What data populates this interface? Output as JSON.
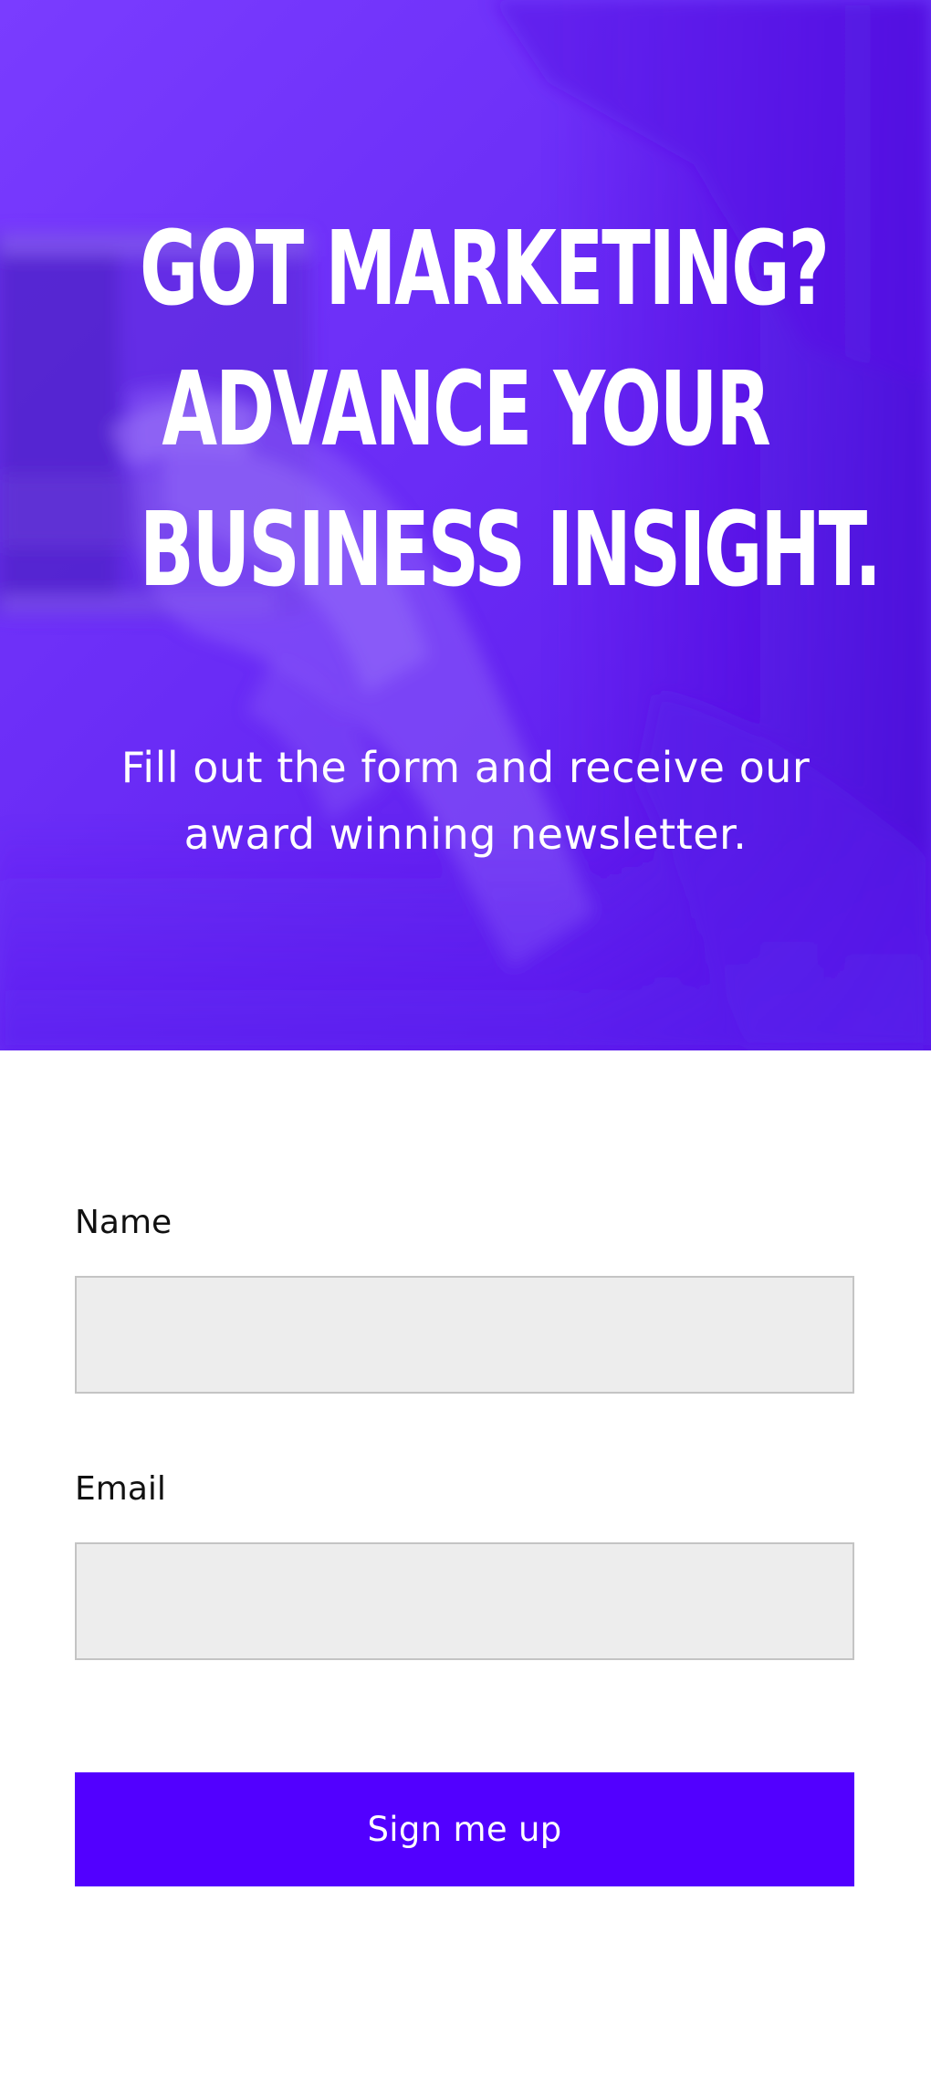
{
  "hero": {
    "title_lines": [
      "GOT MARKETING?",
      "ADVANCE YOUR",
      "BUSINESS INSIGHT."
    ],
    "subtitle_lines": [
      "Fill out the form and receive our",
      "award winning newsletter."
    ],
    "overlay_color": "#6a2cf6"
  },
  "form": {
    "name_label": "Name",
    "name_value": "",
    "email_label": "Email",
    "email_value": "",
    "submit_label": "Sign me up",
    "button_color": "#5200ff"
  }
}
